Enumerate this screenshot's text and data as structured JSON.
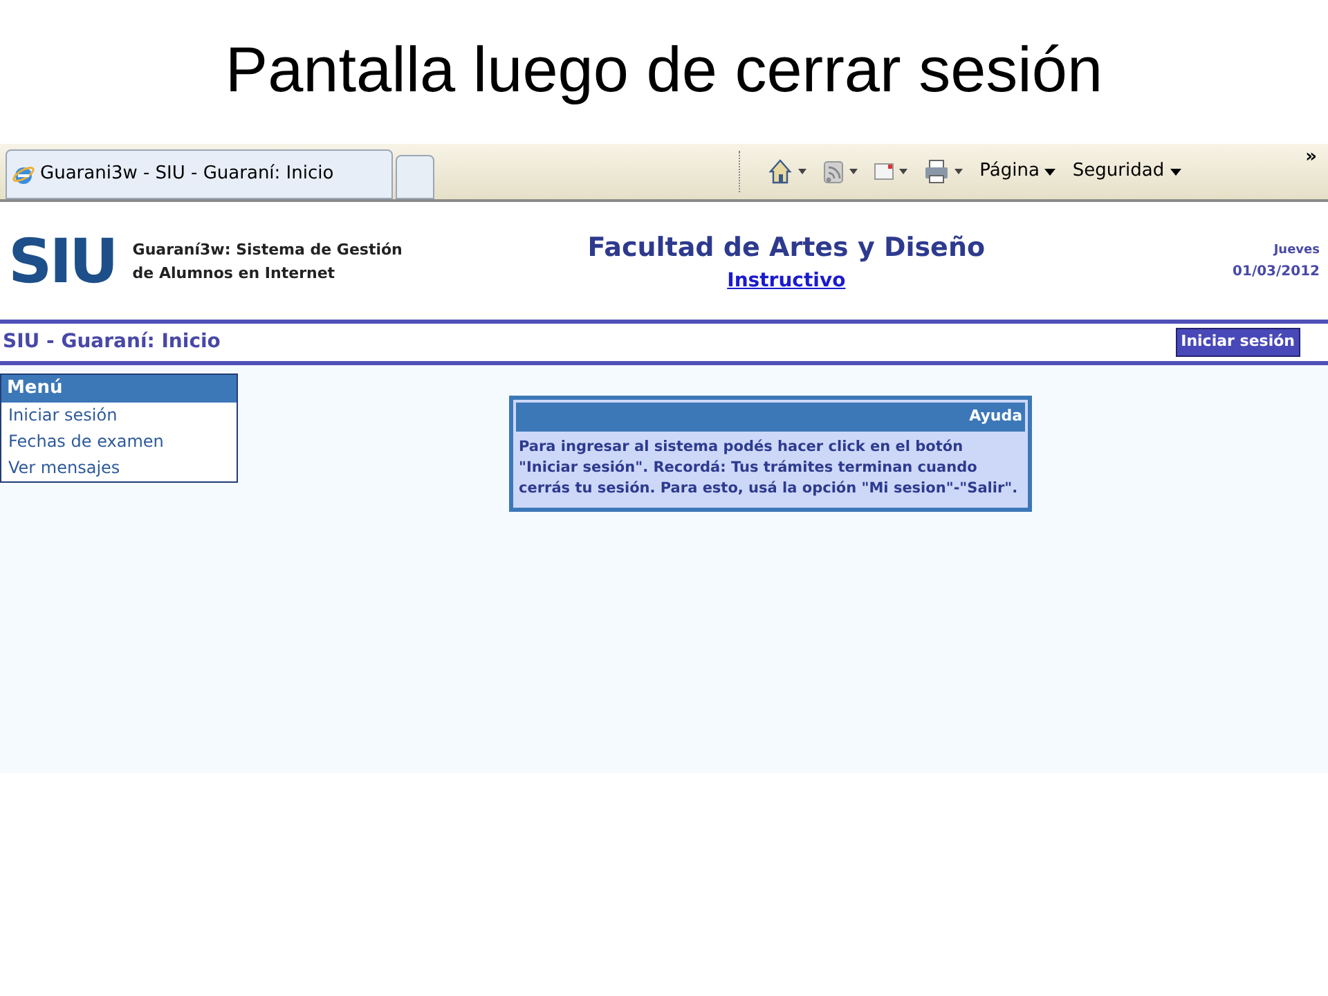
{
  "slide_title": "Pantalla luego de cerrar sesión",
  "browser": {
    "tab_title": "Guarani3w - SIU - Guaraní: Inicio",
    "toolbar": [
      {
        "kind": "home"
      },
      {
        "kind": "feed"
      },
      {
        "kind": "mail"
      },
      {
        "kind": "print"
      },
      {
        "kind": "menu",
        "label": "Página"
      },
      {
        "kind": "menu",
        "label": "Seguridad"
      }
    ],
    "overflow": "»"
  },
  "header": {
    "logo": "SIU",
    "system_line1": "Guaraní3w: Sistema de Gestión",
    "system_line2": "de Alumnos en Internet",
    "faculty": "Facultad de Artes y Diseño",
    "link": "Instructivo",
    "day": "Jueves",
    "date": "01/03/2012"
  },
  "breadcrumb": "SIU - Guaraní: Inicio",
  "login_button": "Iniciar sesión",
  "menu": {
    "title": "Menú",
    "items": [
      {
        "label": "Iniciar sesión"
      },
      {
        "label": "Fechas de examen"
      },
      {
        "label": "Ver mensajes"
      }
    ]
  },
  "help": {
    "title": "Ayuda",
    "text": "Para ingresar al sistema podés hacer click en el botón \"Iniciar sesión\". Recordá: Tus trámites terminan cuando cerrás tu sesión. Para esto, usá la opción \"Mi sesion\"-\"Salir\"."
  }
}
